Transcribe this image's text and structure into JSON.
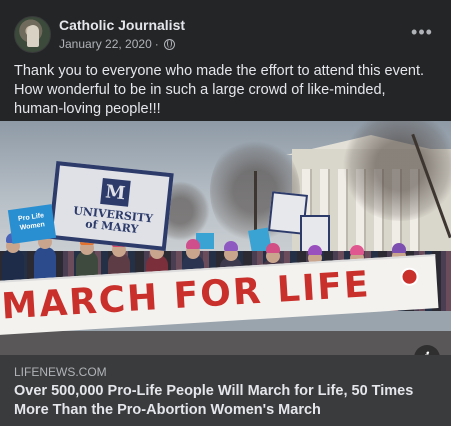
{
  "post": {
    "author": "Catholic Journalist",
    "date": "January 22, 2020",
    "date_separator": " · ",
    "audience_icon": "globe-icon",
    "menu_icon": "more-horizontal-icon",
    "menu_label": "•••",
    "text": "Thank you to everyone who made the effort to attend this event. How wonderful to be in such a large crowd of like-minded, human-loving people!!!"
  },
  "photo": {
    "banner_text": "MARCH FOR LIFE",
    "sign_university_line1": "UNIVERSITY",
    "sign_university_line2": "of MARY",
    "sign_logo": "M",
    "sign_blue_text": "Pro Life Women",
    "info_icon": "info-icon",
    "info_label": "i"
  },
  "link": {
    "domain": "LIFENEWS.COM",
    "title": "Over 500,000 Pro-Life People Will March for Life, 50 Times More Than the Pro-Abortion Women's March"
  },
  "colors": {
    "card_bg": "#242526",
    "link_bg": "#3a3b3c",
    "primary_text": "#e4e6eb",
    "secondary_text": "#b0b3b8",
    "banner_red": "#c9302c"
  }
}
